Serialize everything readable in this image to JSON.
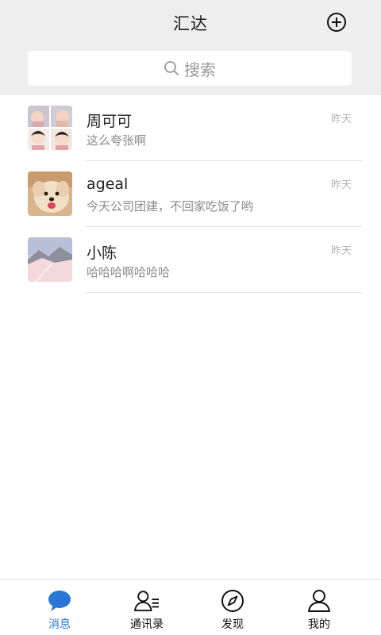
{
  "header": {
    "title": "汇达",
    "add_icon": "plus-circle-icon"
  },
  "search": {
    "placeholder": "搜索",
    "icon": "search-icon"
  },
  "conversations": [
    {
      "name": "周可可",
      "preview": "这么夸张啊",
      "time": "昨天",
      "avatar": "baby-photo-collage"
    },
    {
      "name": "ageal",
      "preview": "今天公司团建，不回家吃饭了哟",
      "time": "昨天",
      "avatar": "puppy-photo"
    },
    {
      "name": "小陈",
      "preview": "哈哈哈啊哈哈哈",
      "time": "昨天",
      "avatar": "snowy-landscape-photo"
    }
  ],
  "tabs": [
    {
      "label": "消息",
      "icon": "chat-bubble-icon",
      "active": true
    },
    {
      "label": "通讯录",
      "icon": "contacts-icon",
      "active": false
    },
    {
      "label": "发现",
      "icon": "compass-icon",
      "active": false
    },
    {
      "label": "我的",
      "icon": "person-icon",
      "active": false
    }
  ],
  "colors": {
    "accent": "#2a75d6",
    "header_bg": "#eeeeee",
    "muted_text": "#8a8a8a"
  }
}
